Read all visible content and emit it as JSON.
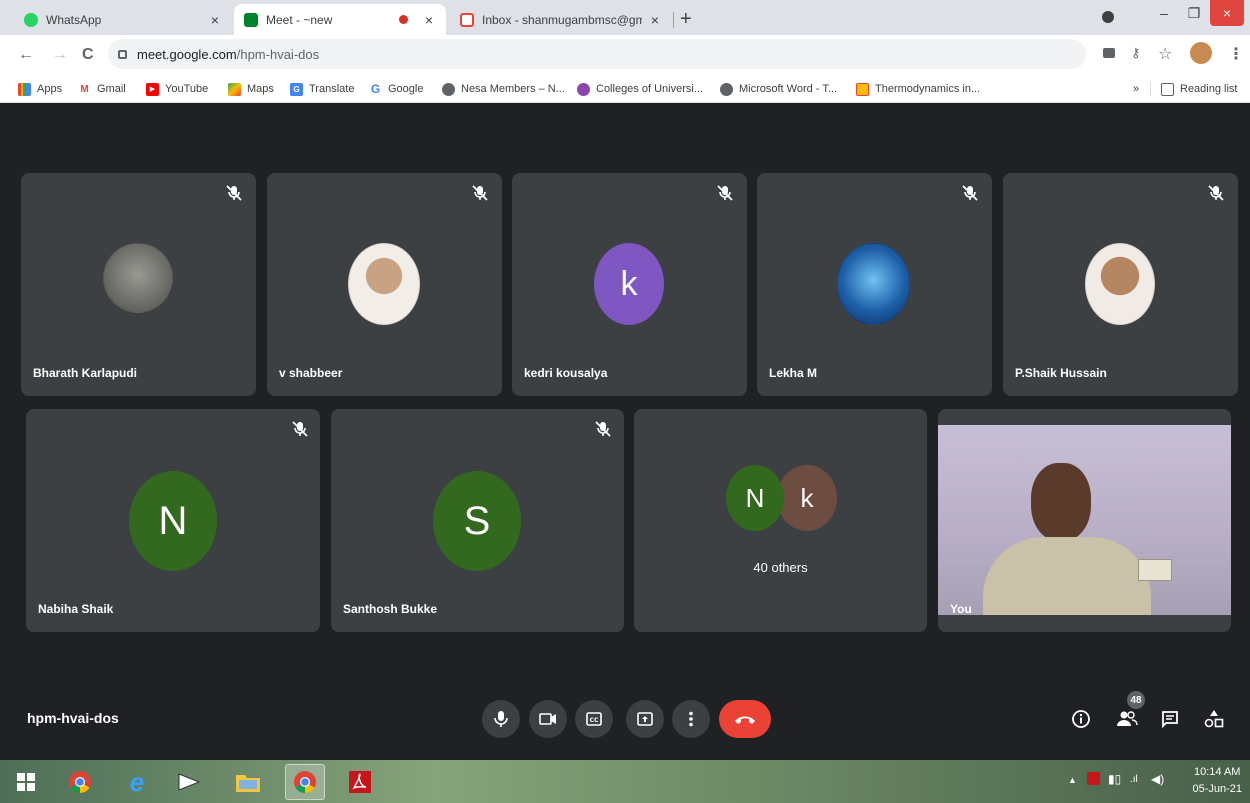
{
  "browser": {
    "tabs": [
      {
        "title": "WhatsApp",
        "close": "×",
        "color": "#25d366"
      },
      {
        "title": "Meet - ~new",
        "close": "×",
        "color": "#00832d"
      },
      {
        "title": "Inbox - shanmugambmsc@gmail",
        "close": "×",
        "color": "#ea4335"
      }
    ],
    "new_tab": "+",
    "window_controls": {
      "minimize": "–",
      "restore": "❐",
      "close": "×"
    },
    "nav": {
      "back": "←",
      "forward": "→",
      "reload": "C"
    },
    "url_host": "meet.google.com",
    "url_path": "/hpm-hvai-dos",
    "bookmarks": [
      {
        "label": "Apps",
        "icon": "apps-grid-icon"
      },
      {
        "label": "Gmail",
        "icon": "gmail-icon"
      },
      {
        "label": "YouTube",
        "icon": "youtube-icon"
      },
      {
        "label": "Maps",
        "icon": "maps-icon"
      },
      {
        "label": "Translate",
        "icon": "translate-icon"
      },
      {
        "label": "Google",
        "icon": "google-icon"
      },
      {
        "label": "Nesa Members – N...",
        "icon": "globe-icon"
      },
      {
        "label": "Colleges of Universi...",
        "icon": "college-icon"
      },
      {
        "label": "Microsoft Word - T...",
        "icon": "globe-icon"
      },
      {
        "label": "Thermodynamics in...",
        "icon": "slides-icon"
      }
    ],
    "more_bookmarks": "»",
    "reading_list": "Reading list"
  },
  "meet": {
    "tiles_row1": [
      {
        "name": "Bharath Karlapudi",
        "avatar_type": "photo",
        "avatar_color": "#6b6b66"
      },
      {
        "name": "v shabbeer",
        "avatar_type": "photo",
        "avatar_color": "#d9c7b3"
      },
      {
        "name": "kedri kousalya",
        "avatar_type": "initial",
        "initial": "k",
        "avatar_color": "#7e57c2"
      },
      {
        "name": "Lekha M",
        "avatar_type": "photo",
        "avatar_color": "#1e5fa8"
      },
      {
        "name": "P.Shaik Hussain",
        "avatar_type": "photo",
        "avatar_color": "#c9a78a"
      }
    ],
    "tiles_row2": [
      {
        "name": "Nabiha Shaik",
        "initial": "N",
        "avatar_color": "#33691e"
      },
      {
        "name": "Santhosh Bukke",
        "initial": "S",
        "avatar_color": "#33691e"
      }
    ],
    "others_tile": {
      "initials": [
        "N",
        "k"
      ],
      "colors": [
        "#33691e",
        "#6d4c41"
      ],
      "label": "40 others"
    },
    "self_tile": {
      "name": "You"
    },
    "meeting_code": "hpm-hvai-dos",
    "participant_count": "48",
    "accent_end_call": "#ea4335"
  },
  "taskbar": {
    "time": "10:14 AM",
    "date": "05-Jun-21"
  }
}
